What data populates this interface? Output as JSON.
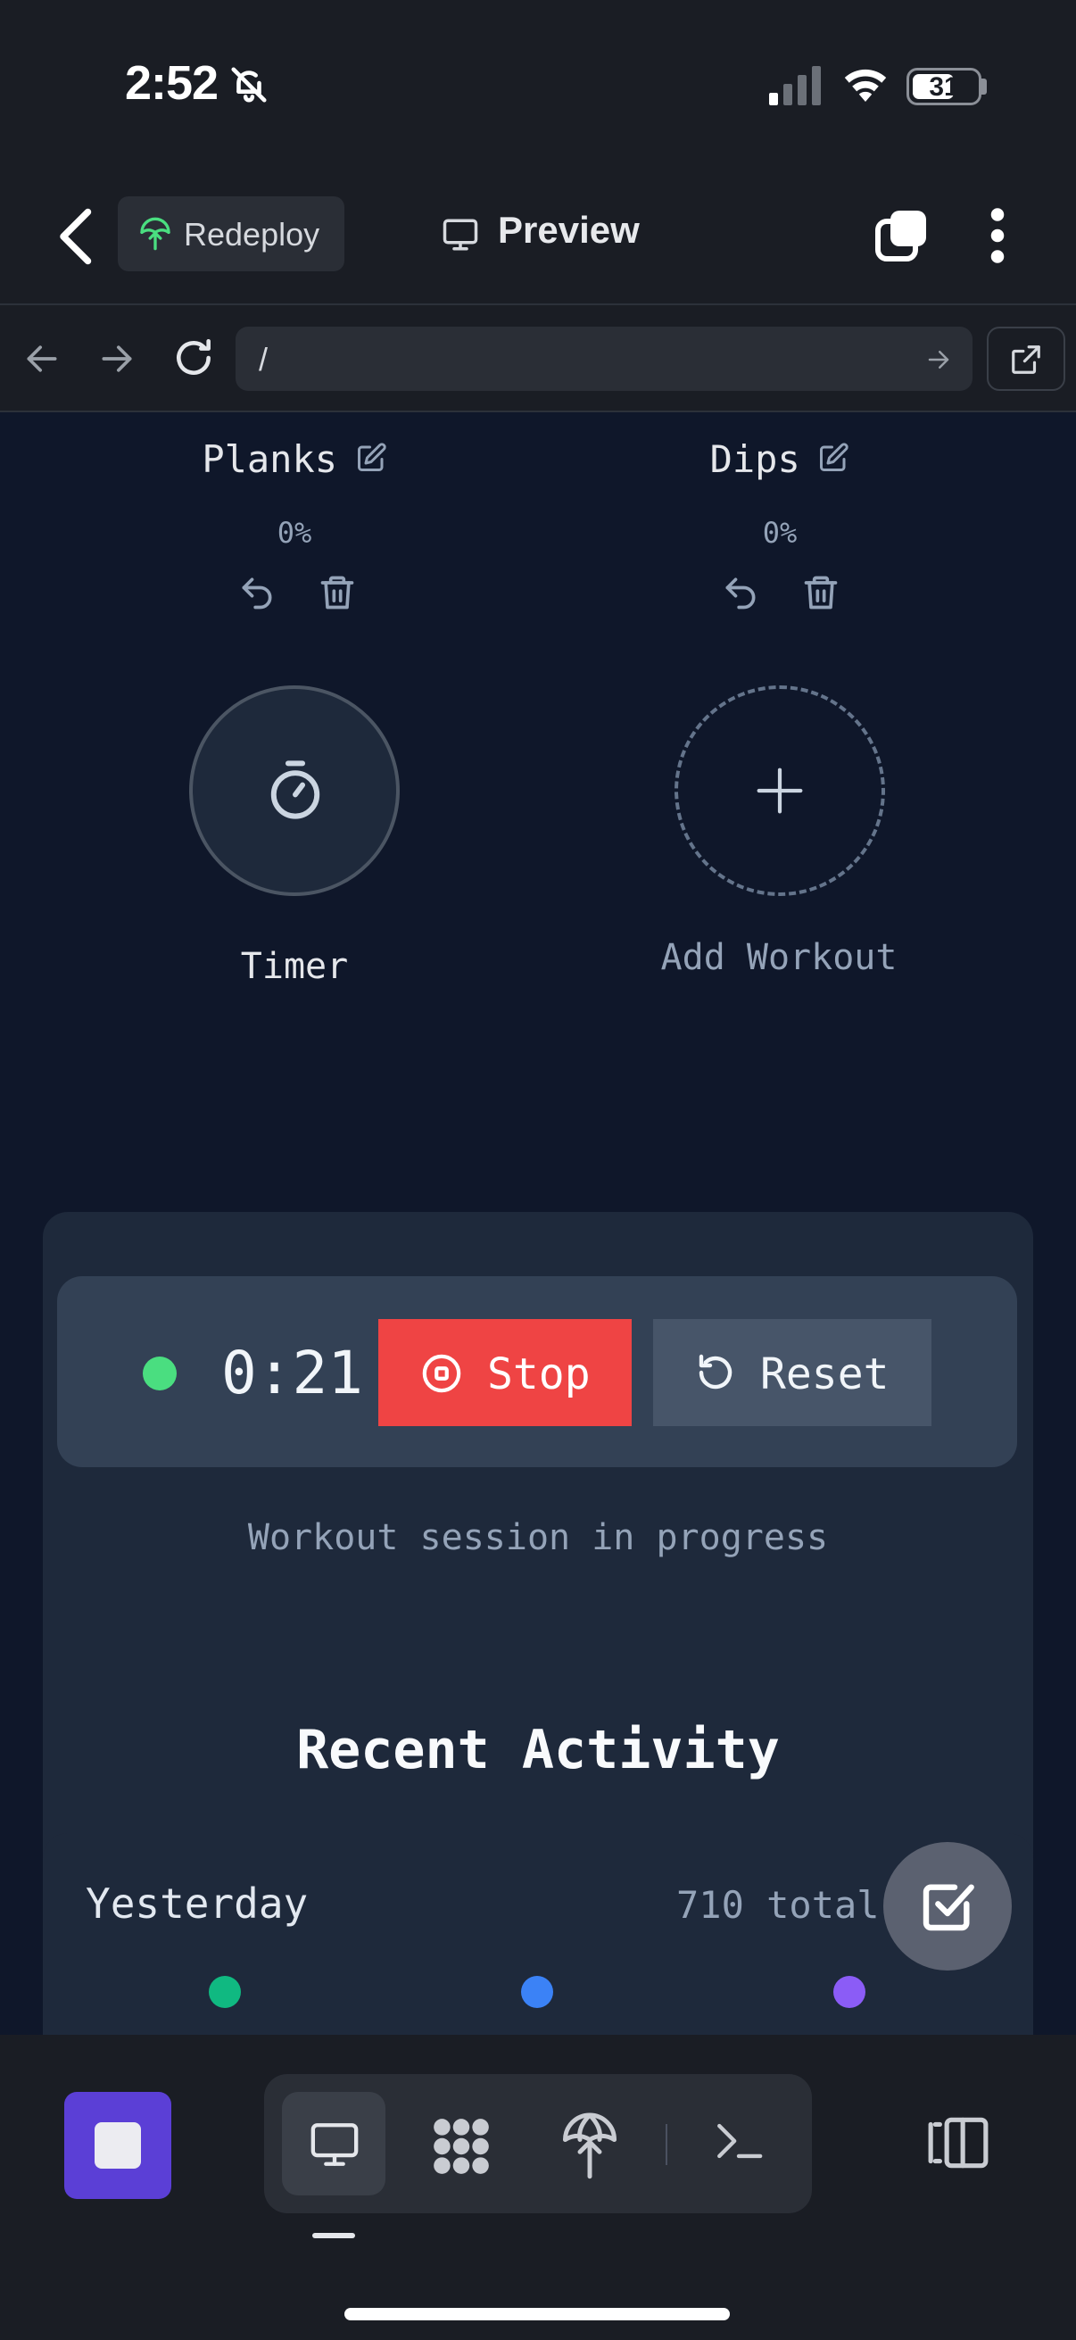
{
  "status_bar": {
    "time": "2:52",
    "battery": "31"
  },
  "app_bar": {
    "redeploy_label": "Redeploy",
    "title": "Preview"
  },
  "browser": {
    "url": "/"
  },
  "workouts": [
    {
      "name": "Planks",
      "progress": "0%"
    },
    {
      "name": "Dips",
      "progress": "0%"
    }
  ],
  "timer_tile": {
    "label": "Timer"
  },
  "add_tile": {
    "label": "Add Workout"
  },
  "session": {
    "elapsed": "0:21",
    "stop_label": "Stop",
    "reset_label": "Reset",
    "status_text": "Workout session in progress"
  },
  "recent": {
    "title": "Recent Activity",
    "day": "Yesterday",
    "total": "710 total",
    "dot_colors": [
      "#10b981",
      "#3b82f6",
      "#8b5cf6"
    ]
  },
  "colors": {
    "accent": "#5b3fd6",
    "stop": "#ef4444",
    "active_dot": "#4ade80",
    "background": "#0f172a"
  }
}
